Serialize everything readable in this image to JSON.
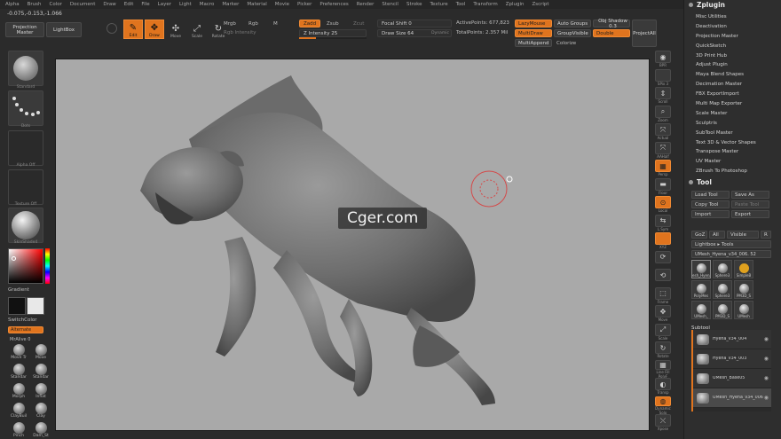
{
  "menu": [
    "Alpha",
    "Brush",
    "Color",
    "Document",
    "Draw",
    "Edit",
    "File",
    "Layer",
    "Light",
    "Macro",
    "Marker",
    "Material",
    "Movie",
    "Picker",
    "Preferences",
    "Render",
    "Stencil",
    "Stroke",
    "Texture",
    "Tool",
    "Transform",
    "Zplugin",
    "Zscript"
  ],
  "coords": "-0.075,-0.153,-1.066",
  "top": {
    "projection_master": "Projection Master",
    "lightbox": "LightBox",
    "tools": [
      {
        "label": "Edit",
        "icon": "edit-icon",
        "glyph": "✎",
        "active": true
      },
      {
        "label": "Draw",
        "icon": "draw-icon",
        "glyph": "✥",
        "active": true
      },
      {
        "label": "Move",
        "icon": "move-icon",
        "glyph": "✣",
        "active": false
      },
      {
        "label": "Scale",
        "icon": "scale-icon",
        "glyph": "⤢",
        "active": false
      },
      {
        "label": "Rotate",
        "icon": "rotate-icon",
        "glyph": "↻",
        "active": false
      }
    ],
    "mrgb": "Mrgb",
    "rgb": "Rgb",
    "m": "M",
    "rgb_intensity": "Rgb Intensity",
    "zadd": "Zadd",
    "zsub": "Zsub",
    "zcut": "Zcut",
    "z_intensity": "Z Intensity 25",
    "z_intensity_value": 0.25,
    "focal_shift": "Focal Shift 0",
    "draw_size": "Draw Size 64",
    "dynamic": "Dynamic",
    "active_points": "ActivePoints: 677,823",
    "total_points": "TotalPoints: 2.357 Mil",
    "lazymouse": "LazyMouse",
    "multidraw": "MultiDraw",
    "multiappend": "MultiAppend",
    "auto_groups": "Auto Groups",
    "groupvisible": "GroupVisible",
    "colorize": "Colorize",
    "floor_shadow": "Obj Shadow 0.3",
    "double": "Double",
    "projectall": "ProjectAll"
  },
  "left": {
    "brush_label": "Standard",
    "stroke_label": "Dots",
    "alpha_label": "Alpha Off",
    "texture_label": "Texture Off",
    "material_label": "SkinShade4",
    "gradient": "Gradient",
    "switchcolor": "SwitchColor",
    "alternate": "Alternate",
    "mrgb_value": "MrAlive 0",
    "brushes": [
      {
        "label": "Move Tr"
      },
      {
        "label": "Move"
      },
      {
        "label": "Standar"
      },
      {
        "label": "Standar"
      },
      {
        "label": "Morph"
      },
      {
        "label": "Inflat"
      },
      {
        "label": "ClayBuil"
      },
      {
        "label": "Clay"
      },
      {
        "label": "Pinch"
      },
      {
        "label": "Dam_St"
      }
    ]
  },
  "right_shelf": [
    {
      "label": "BPR",
      "icon": "bpr-icon",
      "glyph": "◉",
      "orange": false
    },
    {
      "label": "SPix 3",
      "icon": "spix-icon",
      "glyph": "",
      "orange": false
    },
    {
      "label": "Scroll",
      "icon": "scroll-icon",
      "glyph": "⇕",
      "orange": false
    },
    {
      "label": "Zoom",
      "icon": "zoom-icon",
      "glyph": "⌕",
      "orange": false
    },
    {
      "label": "Actual",
      "icon": "actual-icon",
      "glyph": "⤧",
      "orange": false
    },
    {
      "label": "AAHalf",
      "icon": "aahalf-icon",
      "glyph": "⤧",
      "orange": false
    },
    {
      "label": "Persp",
      "icon": "persp-icon",
      "glyph": "▦",
      "orange": true
    },
    {
      "label": "Floor",
      "icon": "floor-icon",
      "glyph": "▬",
      "orange": false
    },
    {
      "label": "Local",
      "icon": "local-icon",
      "glyph": "⊙",
      "orange": true
    },
    {
      "label": "L.Sym",
      "icon": "lsym-icon",
      "glyph": "⇆",
      "orange": false
    },
    {
      "label": "XYZ",
      "icon": "xyz-icon",
      "glyph": "",
      "orange": true
    },
    {
      "label": "",
      "icon": "rotate-y-icon",
      "glyph": "⟳",
      "orange": false
    },
    {
      "label": "",
      "icon": "rotate-z-icon",
      "glyph": "⟲",
      "orange": false
    },
    {
      "label": "Frame",
      "icon": "frame-icon",
      "glyph": "⬚",
      "orange": false
    },
    {
      "label": "Move",
      "icon": "move-view-icon",
      "glyph": "✥",
      "orange": false
    },
    {
      "label": "Scale",
      "icon": "scale-view-icon",
      "glyph": "⤢",
      "orange": false
    },
    {
      "label": "Rotate",
      "icon": "rotate-view-icon",
      "glyph": "↻",
      "orange": false
    },
    {
      "label": "Line Fill PolyF",
      "icon": "polyframe-icon",
      "glyph": "▦",
      "orange": false
    },
    {
      "label": "Transp",
      "icon": "transp-icon",
      "glyph": "◐",
      "orange": false
    },
    {
      "label": "Dynamic Solo",
      "icon": "solo-icon",
      "glyph": "◍",
      "orange": true
    },
    {
      "label": "Xpose",
      "icon": "xpose-icon",
      "glyph": "⤬",
      "orange": false
    }
  ],
  "panel": {
    "zplugin_title": "Zplugin",
    "plugins": [
      "Misc Utilities",
      "Deactivation",
      "Projection Master",
      "QuickSketch",
      "3D Print Hub",
      "Adjust Plugin",
      "Maya Blend Shapes",
      "Decimation Master",
      "FBX ExportImport",
      "Multi Map Exporter",
      "Scale Master",
      "Sculptris",
      "SubTool Master",
      "Text 3D & Vector Shapes",
      "Transpose Master",
      "UV Master",
      "ZBrush To Photoshop"
    ],
    "tool_title": "Tool",
    "load_tool": "Load Tool",
    "save_as": "Save As",
    "copy_tool": "Copy Tool",
    "paste_tool": "Paste Tool",
    "import": "Import",
    "export": "Export",
    "goz": "GoZ",
    "all": "All",
    "visible": "Visible",
    "r": "R",
    "lightbox_tools": "Lightbox ▸ Tools",
    "current_tool": "UMesh_Hyena_v34_006. 52",
    "tool_thumbs": [
      "UMesh_Hyena_v",
      "Sphere3",
      "SimpleB",
      "PolyMes",
      "Sphere3",
      "PM3D_S",
      "UMesh_",
      "PM3D_S",
      "UMesh"
    ],
    "subtool_title": "Subtool",
    "subtools": [
      "Hyena_v34_004",
      "Hyena_v34_003",
      "UMesh_Base05",
      "UMesh_Hyena_v34_006"
    ]
  },
  "watermark": "Cger.com",
  "colors": {
    "accent": "#e0741e",
    "canvas": "#a9a9a9"
  }
}
